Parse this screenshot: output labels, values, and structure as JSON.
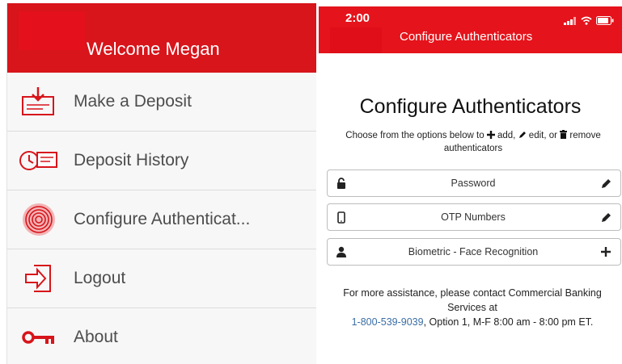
{
  "left_panel": {
    "welcome": "Welcome Megan",
    "menu": [
      {
        "label": "Make a Deposit",
        "icon": "deposit-icon"
      },
      {
        "label": "Deposit History",
        "icon": "deposit-history-icon"
      },
      {
        "label": "Configure Authenticat...",
        "icon": "fingerprint-icon"
      },
      {
        "label": "Logout",
        "icon": "logout-icon"
      },
      {
        "label": "About",
        "icon": "key-icon"
      }
    ]
  },
  "right_panel": {
    "status": {
      "time": "2:00"
    },
    "header_title": "Configure Authenticators",
    "heading": "Configure Authenticators",
    "subtitle": {
      "part1": "Choose from the options below to",
      "add": "add,",
      "edit": "edit, or",
      "remove": "remove authenticators"
    },
    "authenticators": [
      {
        "label": "Password",
        "icon": "lock-icon",
        "action": "edit"
      },
      {
        "label": "OTP Numbers",
        "icon": "phone-icon",
        "action": "edit"
      },
      {
        "label": "Biometric - Face Recognition",
        "icon": "person-icon",
        "action": "add"
      }
    ],
    "assistance": {
      "line1": "For more assistance, please contact Commercial Banking Services at",
      "phone": "1-800-539-9039",
      "line2": ", Option 1, M-F 8:00 am - 8:00 pm ET."
    }
  },
  "colors": {
    "brand_red": "#d7151b",
    "link_blue": "#3a6ea5"
  }
}
